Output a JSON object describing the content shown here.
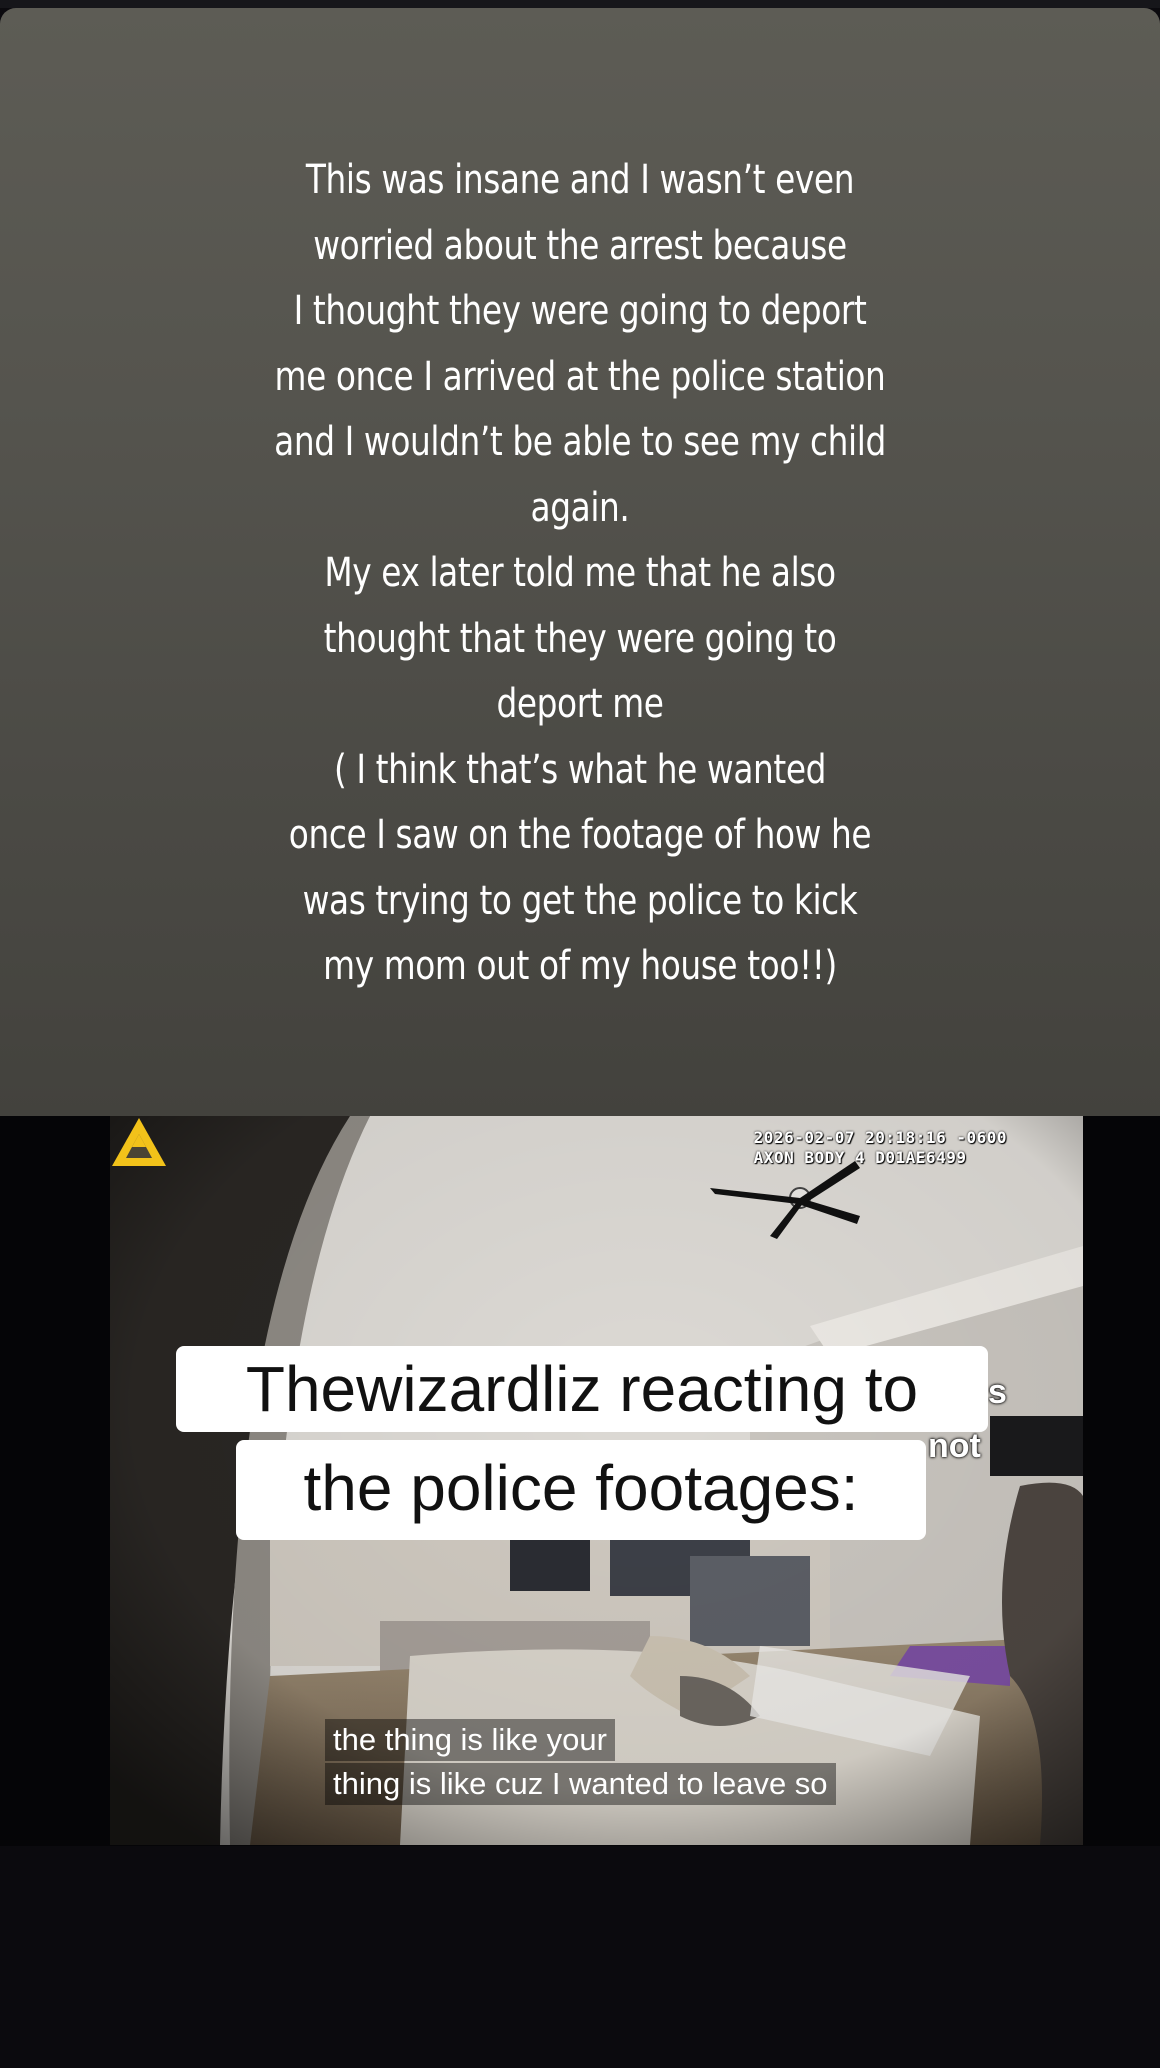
{
  "story": {
    "text": "This was insane and I wasn’t even\nworried about the arrest because\nI thought they were going to deport\nme once I arrived at the police station\nand I wouldn’t be able to see my child\nagain.\nMy ex later told me that he also\nthought that they were going to\ndeport me\n( I think that’s what he wanted\nonce I saw on the footage of how he\nwas trying to get the police to kick\nmy mom out of my house too!!)"
  },
  "video": {
    "timestamp": "2026-02-07 20:18:16 -0600",
    "device": "AXON BODY 4 D01AE6499",
    "logo_icon": "axon-triangle-icon",
    "overlay_caption": {
      "line1": "Thewizardliz reacting to",
      "line2": "the police footages:"
    },
    "cut_off_text": {
      "right_top": "s",
      "right_bottom": "not"
    },
    "subtitles": [
      "the thing is like your",
      "thing is like cuz I wanted to leave so"
    ]
  },
  "colors": {
    "card_top": "#5d5c55",
    "card_bottom": "#43423d",
    "page_background": "#0b0a0e",
    "axon_yellow": "#f2c21a"
  }
}
